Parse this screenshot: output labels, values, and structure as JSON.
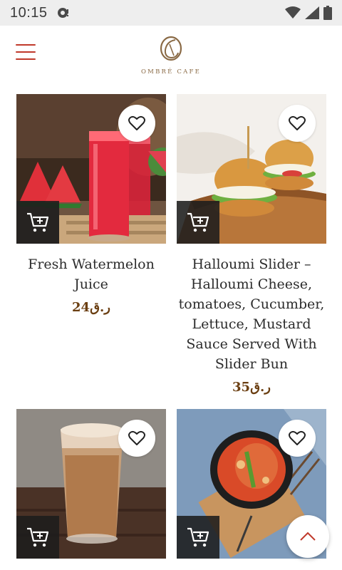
{
  "status_bar": {
    "time": "10:15"
  },
  "header": {
    "logo_text": "OMBRÉ CAFE"
  },
  "products": [
    {
      "title": "Fresh Watermelon Juice",
      "price": "24ر.ق"
    },
    {
      "title": "Halloumi Slider – Halloumi Cheese, tomatoes, Cucumber, Lettuce, Mustard Sauce Served With Slider Bun",
      "price": "35ر.ق"
    },
    {
      "title": "",
      "price": ""
    },
    {
      "title": "",
      "price": ""
    }
  ],
  "colors": {
    "accent": "#c0392b",
    "price": "#6b3f12",
    "logo": "#8a6a45"
  }
}
